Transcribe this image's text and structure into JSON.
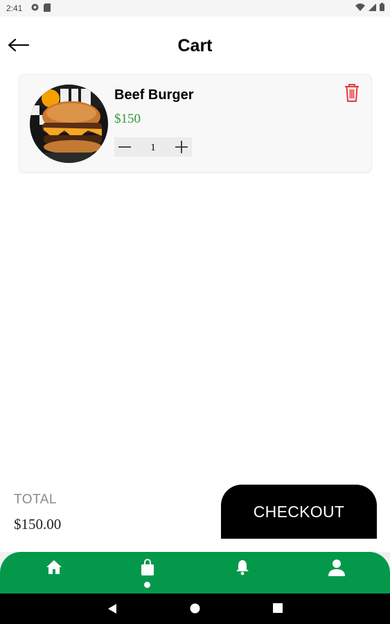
{
  "status_bar": {
    "time": "2:41"
  },
  "header": {
    "title": "Cart"
  },
  "cart": {
    "items": [
      {
        "name": "Beef Burger",
        "price": "$150",
        "quantity": "1"
      }
    ]
  },
  "summary": {
    "total_label": "TOTAL",
    "total_value": "$150.00"
  },
  "checkout": {
    "label": "CHECKOUT"
  },
  "bottom_nav": {
    "items": [
      "home-icon",
      "shopping-bag-icon",
      "bell-icon",
      "profile-icon"
    ],
    "active_index": 1
  },
  "colors": {
    "accent_green": "#04984b",
    "price_green": "#2e9a3a",
    "delete_red": "#e53935",
    "checkout_bg": "#000000"
  }
}
